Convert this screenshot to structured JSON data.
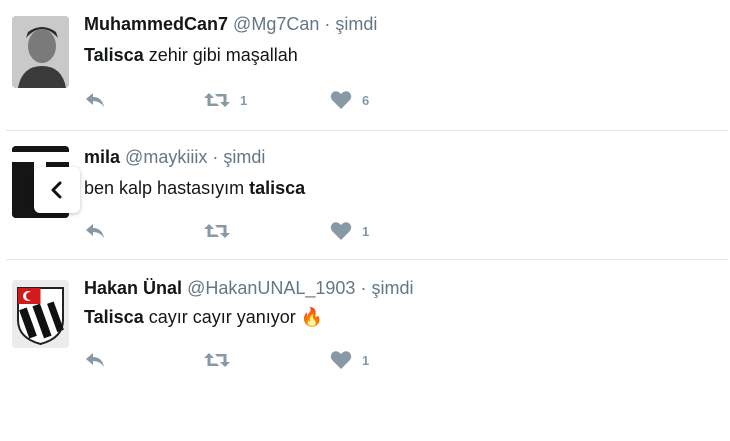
{
  "tweets": [
    {
      "name": "MuhammedCan7",
      "handle": "@Mg7Can",
      "dot": "·",
      "time": "şimdi",
      "text_bold": "Talisca",
      "text_rest": " zehir gibi maşallah",
      "retweets": "1",
      "likes": "6",
      "avatar_icon": "user-photo-icon"
    },
    {
      "name": "mila",
      "handle": "@maykiiix",
      "dot": "·",
      "time": "şimdi",
      "text_rest": "ben kalp hastasıyım ",
      "text_bold": "talisca",
      "retweets": "",
      "likes": "1",
      "avatar_icon": "user-photo-icon"
    },
    {
      "name": "Hakan Ünal",
      "handle": "@HakanUNAL_1903",
      "dot": "·",
      "time": "şimdi",
      "text_bold": "Talisca",
      "text_rest": " cayır cayır yanıyor ",
      "emoji": "🔥",
      "retweets": "",
      "likes": "1",
      "avatar_icon": "besiktas-logo-icon"
    }
  ],
  "colors": {
    "icon": "#8899a6",
    "text": "#14171a",
    "meta": "#657786",
    "divider": "#e1e8ed"
  },
  "overlay": {
    "back_icon": "chevron-left-icon"
  }
}
